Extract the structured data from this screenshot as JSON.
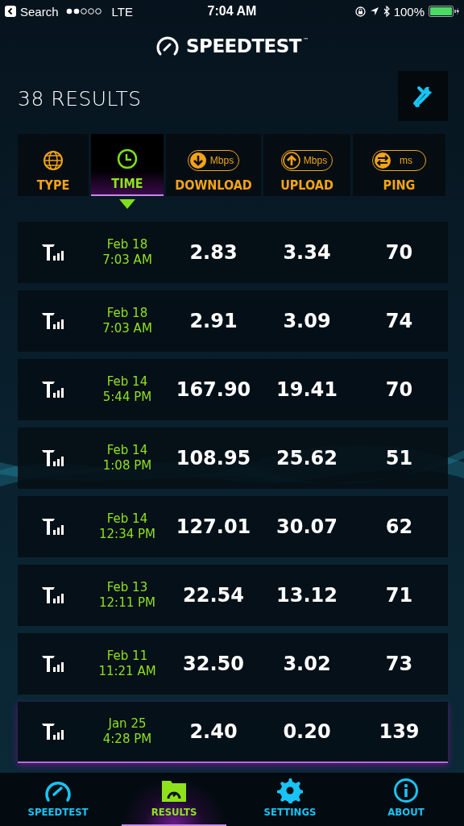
{
  "status_bar": {
    "back_label": "Search",
    "carrier": "LTE",
    "time": "7:04 AM",
    "battery": "100%"
  },
  "logo": {
    "name": "SPEEDTEST",
    "mark": "™"
  },
  "title": "38 RESULTS",
  "columns": [
    {
      "kind": "type",
      "label": "TYPE",
      "selected": false
    },
    {
      "kind": "time",
      "label": "TIME",
      "selected": true
    },
    {
      "kind": "download",
      "label": "DOWNLOAD",
      "unit": "Mbps",
      "selected": false
    },
    {
      "kind": "upload",
      "label": "UPLOAD",
      "unit": "Mbps",
      "selected": false
    },
    {
      "kind": "ping",
      "label": "PING",
      "unit": "ms",
      "selected": false
    }
  ],
  "rows": [
    {
      "date": "Feb 18",
      "time": "7:03 AM",
      "download": "2.83",
      "upload": "3.34",
      "ping": "70"
    },
    {
      "date": "Feb 18",
      "time": "7:03 AM",
      "download": "2.91",
      "upload": "3.09",
      "ping": "74"
    },
    {
      "date": "Feb 14",
      "time": "5:44 PM",
      "download": "167.90",
      "upload": "19.41",
      "ping": "70"
    },
    {
      "date": "Feb 14",
      "time": "1:08 PM",
      "download": "108.95",
      "upload": "25.62",
      "ping": "51"
    },
    {
      "date": "Feb 14",
      "time": "12:34 PM",
      "download": "127.01",
      "upload": "30.07",
      "ping": "62"
    },
    {
      "date": "Feb 13",
      "time": "12:11 PM",
      "download": "22.54",
      "upload": "13.12",
      "ping": "71"
    },
    {
      "date": "Feb 11",
      "time": "11:21 AM",
      "download": "32.50",
      "upload": "3.02",
      "ping": "73"
    },
    {
      "date": "Jan 25",
      "time": "4:28 PM",
      "download": "2.40",
      "upload": "0.20",
      "ping": "139"
    }
  ],
  "tabs": [
    {
      "kind": "speedtest",
      "label": "SPEEDTEST",
      "selected": false
    },
    {
      "kind": "results",
      "label": "RESULTS",
      "selected": true
    },
    {
      "kind": "settings",
      "label": "SETTINGS",
      "selected": false
    },
    {
      "kind": "about",
      "label": "ABOUT",
      "selected": false
    }
  ]
}
